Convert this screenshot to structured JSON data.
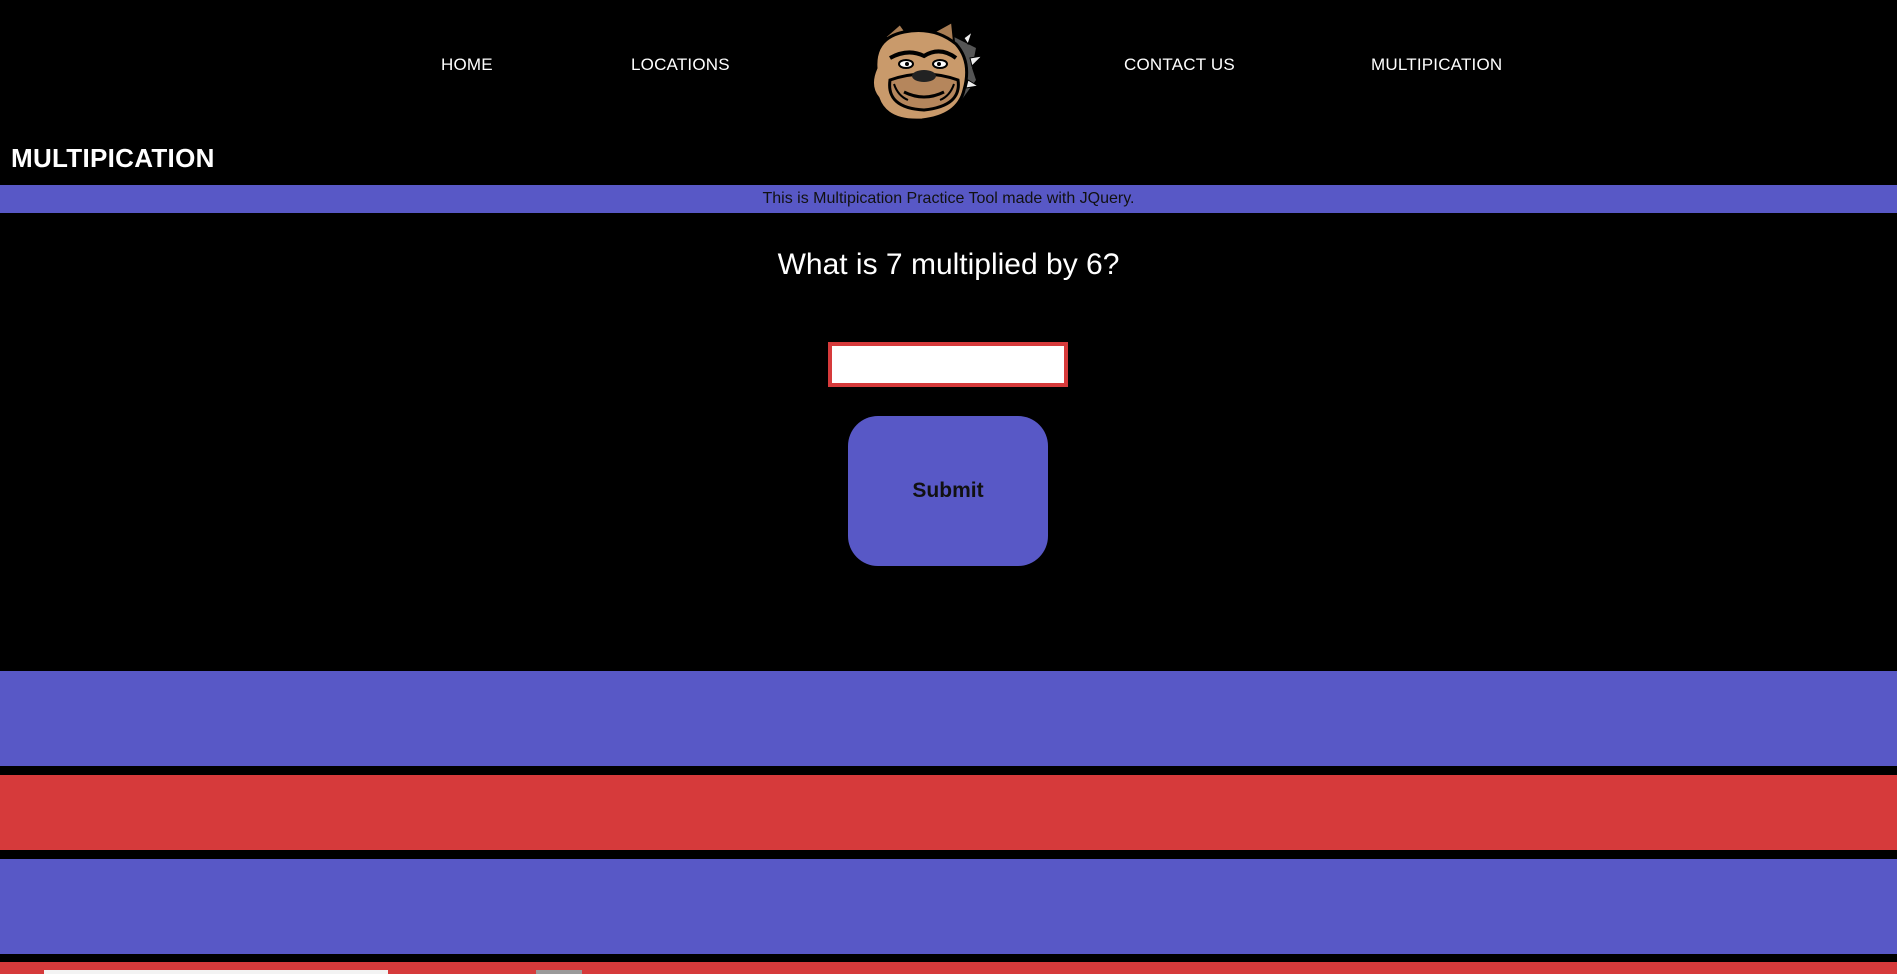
{
  "nav": {
    "items": [
      {
        "label": "HOME"
      },
      {
        "label": "LOCATIONS"
      },
      {
        "label": "CONTACT US"
      },
      {
        "label": "MULTIPICATION"
      }
    ],
    "logo_icon": "bulldog-logo-icon"
  },
  "page": {
    "heading": "MULTIPICATION",
    "subtitle": "This is Multipication Practice Tool made with JQuery."
  },
  "quiz": {
    "question": "What is 7 multiplied by 6?",
    "answer_value": "",
    "submit_label": "Submit"
  },
  "colors": {
    "background": "#000000",
    "accent_blue": "#5858c6",
    "accent_red": "#d63a3b",
    "text": "#ffffff"
  }
}
